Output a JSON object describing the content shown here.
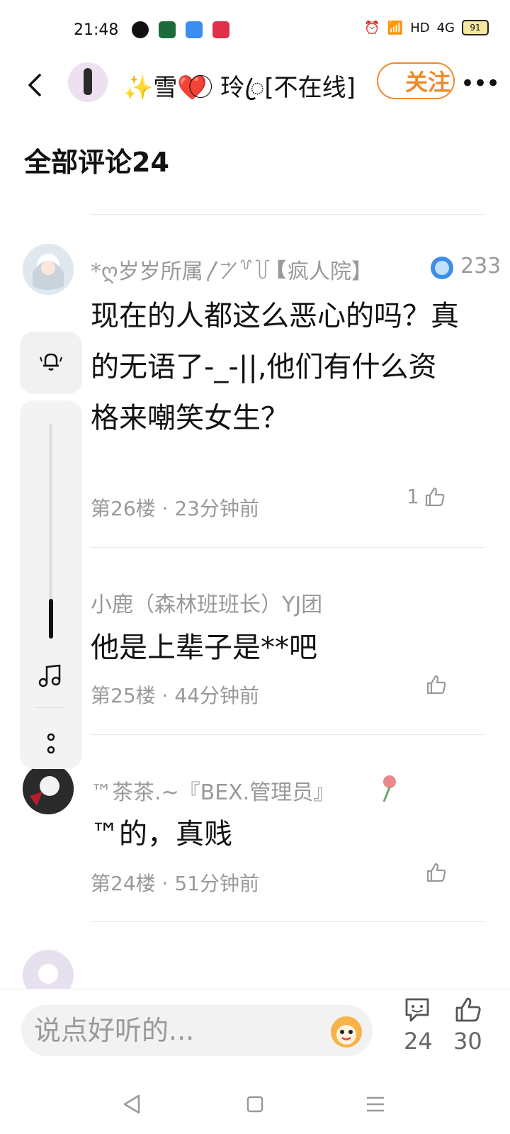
{
  "status_bar": {
    "time": "21:48",
    "right_text": "HD",
    "network": "4G",
    "battery": "91"
  },
  "header": {
    "title": "✨雪❤️ ⃝ 玲ꦿ[不在线]",
    "follow_label": "关注",
    "more": "•••"
  },
  "comments_title": "全部评论24",
  "comments": [
    {
      "user": "*ღ岁岁所属〳 ⃗ ̸꒷꒦【疯人院】",
      "badge_count": "233",
      "text": "现在的人都这么恶心的吗？真的无语了-_-||,他们有什么资格来嘲笑女生？",
      "meta": "第26楼 · 23分钟前",
      "likes": "1"
    },
    {
      "user": "小鹿（森林班班长）YJ团",
      "text": "他是上辈子是**吧",
      "meta": "第25楼 · 44分钟前",
      "likes": ""
    },
    {
      "user": "™茶茶.~『BEX.管理员』",
      "text": "™的，真贱",
      "meta": "第24楼 · 51分钟前",
      "likes": ""
    }
  ],
  "bottom_bar": {
    "input_placeholder": "说点好听的...",
    "comment_count": "24",
    "like_count": "30"
  },
  "icons": {
    "back": "chevron-left-icon",
    "bell": "bell-icon",
    "music": "music-note-icon",
    "more_vertical": "more-vertical-icon",
    "like": "thumb-up-icon",
    "comment": "chat-smile-icon"
  },
  "colors": {
    "accent": "#f08a2a",
    "muted_text": "#999999",
    "panel_bg": "#f2f2f2"
  }
}
